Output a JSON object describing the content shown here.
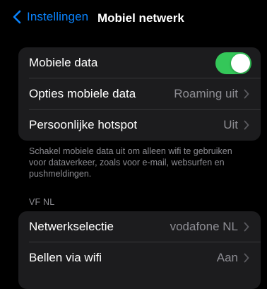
{
  "nav": {
    "back_label": "Instellingen",
    "title": "Mobiel netwerk"
  },
  "group1": {
    "mobile_data": {
      "label": "Mobiele data",
      "toggle_on": true
    },
    "options": {
      "label": "Opties mobiele data",
      "value": "Roaming uit"
    },
    "hotspot": {
      "label": "Persoonlijke hotspot",
      "value": "Uit"
    }
  },
  "footer_note": "Schakel mobiele data uit om alleen wifi te gebruiken voor dataverkeer, zoals voor e-mail, websurfen en pushmeldingen.",
  "section2": {
    "header": "VF NL",
    "network_selection": {
      "label": "Netwerkselectie",
      "value": "vodafone NL"
    },
    "wifi_calling": {
      "label": "Bellen via wifi",
      "value": "Aan"
    }
  },
  "colors": {
    "accent": "#0a84ff",
    "toggle_on": "#34c759",
    "background": "#000000",
    "cell": "#1c1c1e",
    "secondary_text": "#8d8d93"
  },
  "icons": {
    "back": "chevron-left-icon",
    "disclosure": "chevron-right-icon"
  }
}
